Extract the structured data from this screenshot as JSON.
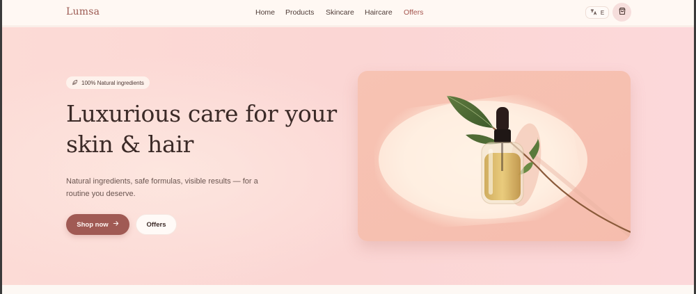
{
  "brand": {
    "logo": "Lumsa",
    "accent": "#a05a54",
    "hero_bg": "#fcd9d5"
  },
  "nav": {
    "items": [
      {
        "label": "Home",
        "active": false
      },
      {
        "label": "Products",
        "active": false
      },
      {
        "label": "Skincare",
        "active": false
      },
      {
        "label": "Haircare",
        "active": false
      },
      {
        "label": "Offers",
        "active": true
      }
    ]
  },
  "header": {
    "lang_label": "E",
    "lang_icon": "translate-icon",
    "cart_icon": "shopping-bag-icon"
  },
  "hero": {
    "badge": {
      "icon": "leaf-icon",
      "text": "100% Natural ingredients"
    },
    "title_line1": "Luxurious care for your",
    "title_line2": "skin & hair",
    "subtitle_line1": "Natural ingredients, safe formulas, visible results — for a",
    "subtitle_line2": "routine you deserve.",
    "primary_cta": "Shop now",
    "secondary_cta": "Offers",
    "image": "serum-bottle-with-leaves-photo"
  }
}
